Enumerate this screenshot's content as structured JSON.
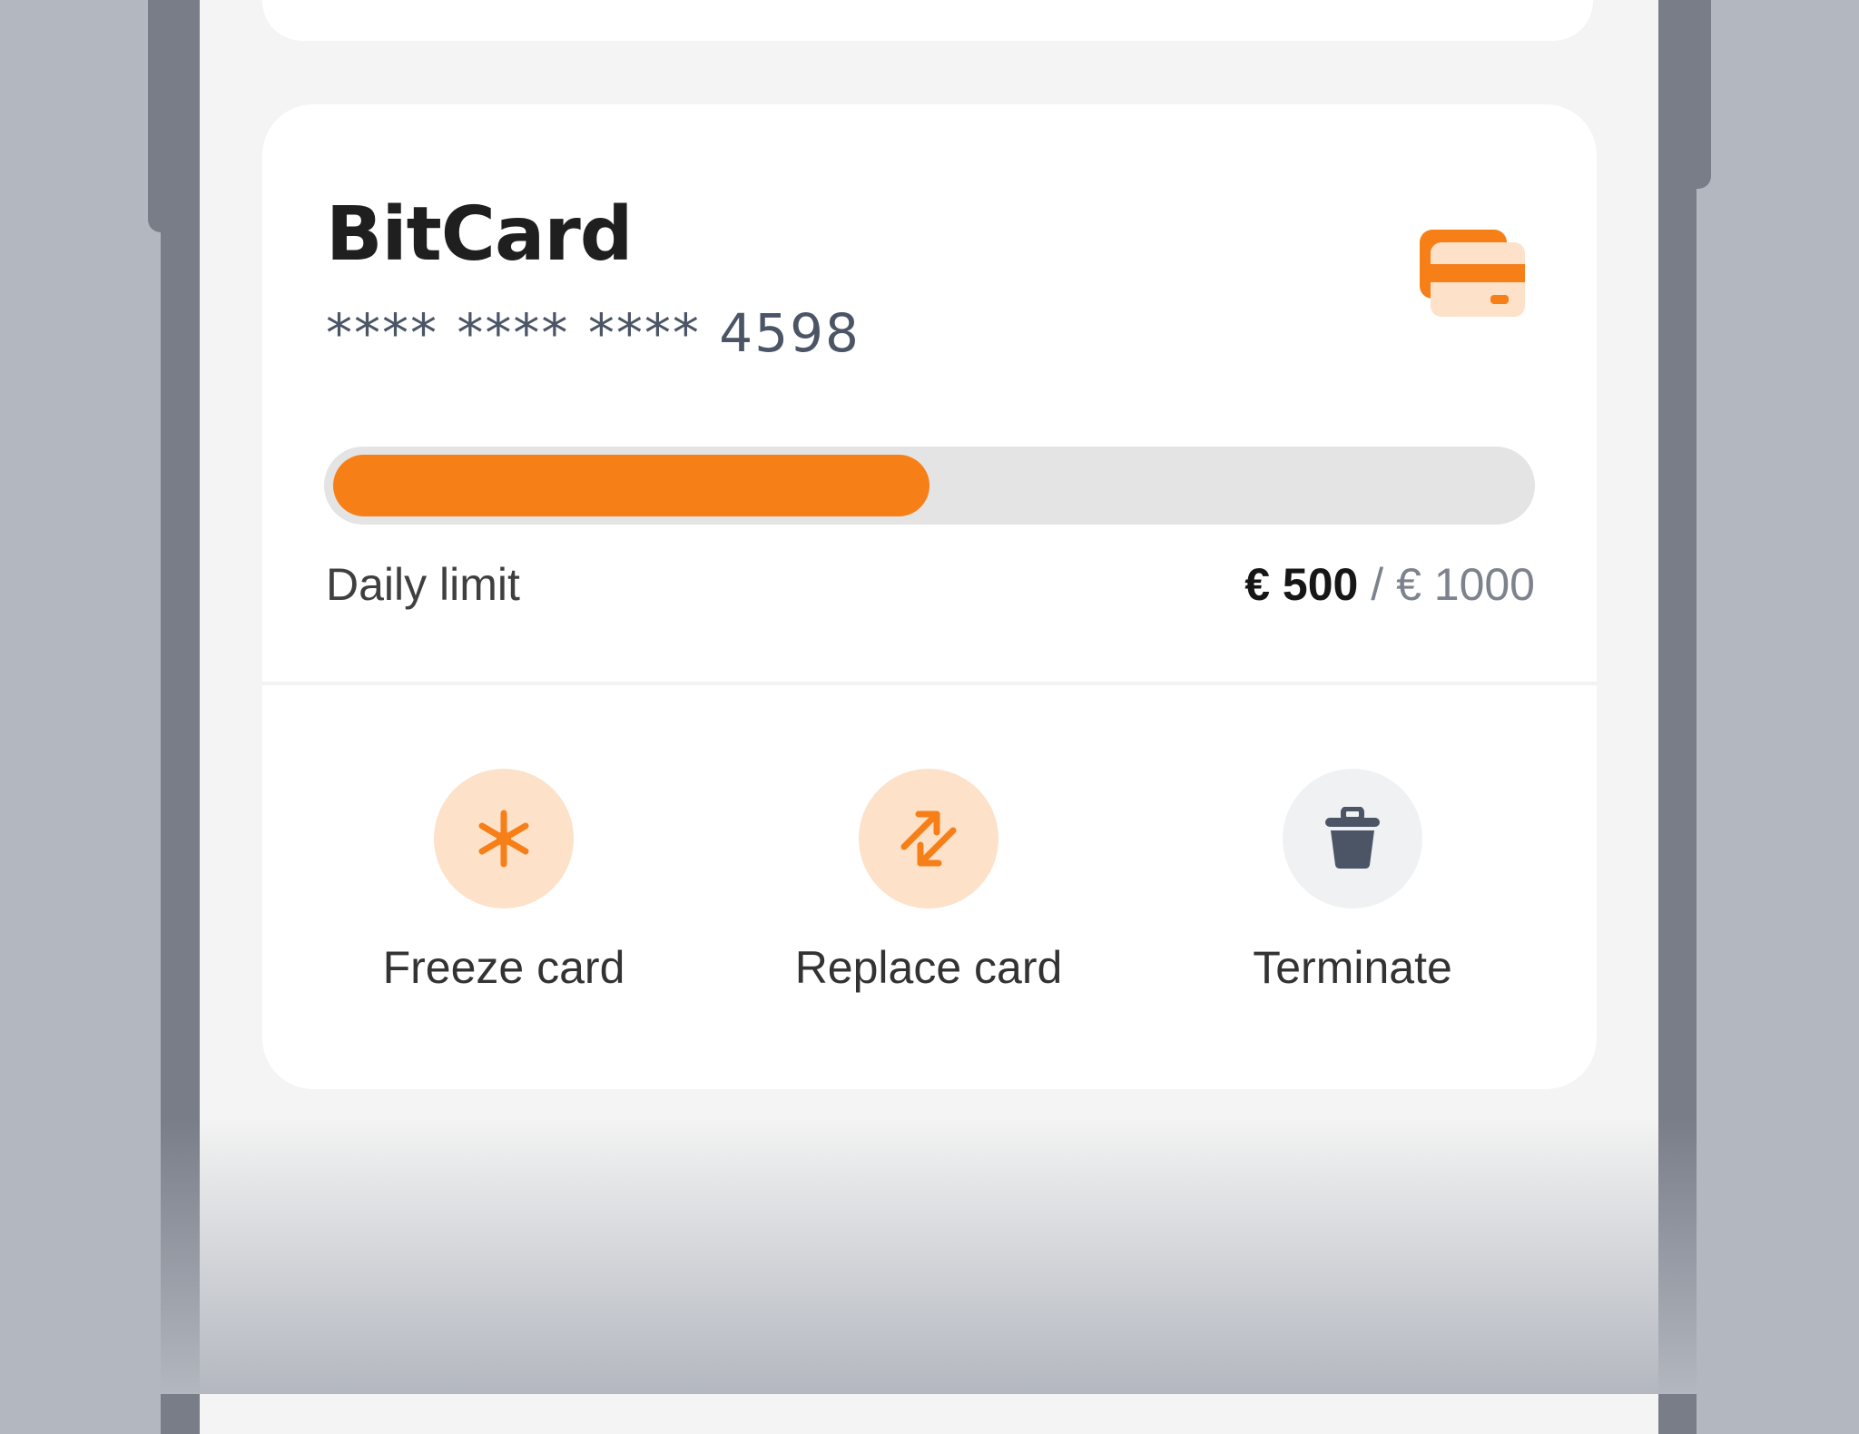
{
  "card": {
    "name": "BitCard",
    "masked_number": "**** **** **** 4598",
    "icon": "credit-card-icon"
  },
  "limit": {
    "label": "Daily limit",
    "used_display": "€ 500",
    "separator": "/",
    "max_display": "€ 1000",
    "used": 500,
    "max": 1000,
    "fraction": 0.5
  },
  "actions": [
    {
      "label": "Freeze card",
      "icon": "snowflake-icon"
    },
    {
      "label": "Replace card",
      "icon": "swap-arrows-icon"
    },
    {
      "label": "Terminate",
      "icon": "trash-icon"
    }
  ],
  "colors": {
    "accent": "#f77f17",
    "accent_soft": "#fde1c9",
    "neutral_soft": "#f0f1f3",
    "icon_dark": "#4b5566"
  }
}
